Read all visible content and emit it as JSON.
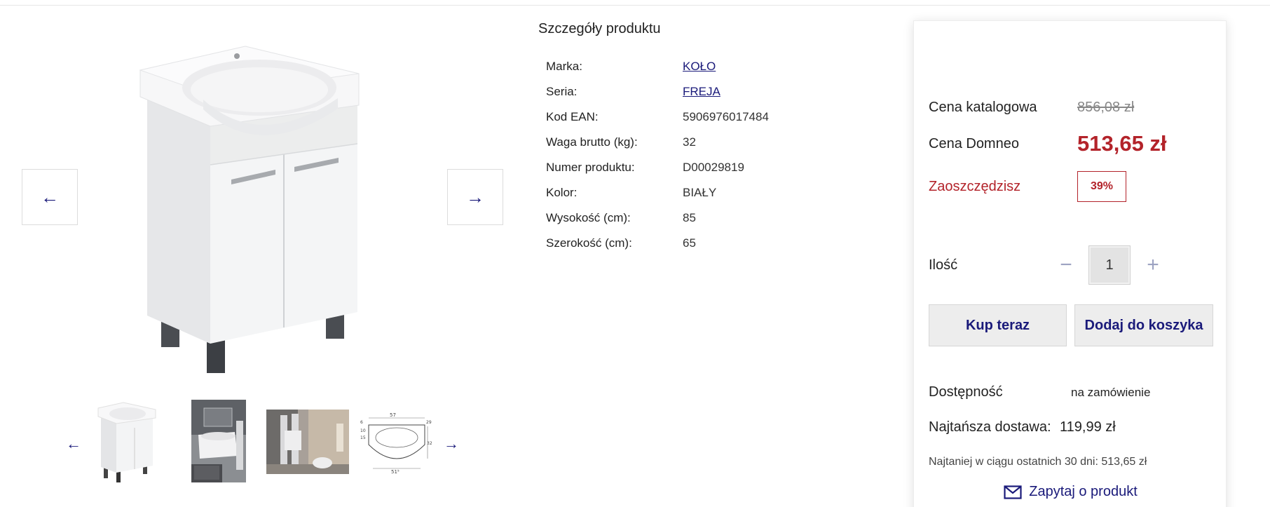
{
  "gallery": {
    "prev_arrow": "←",
    "next_arrow": "→",
    "thumb_prev": "←",
    "thumb_next": "→"
  },
  "details": {
    "title": "Szczegóły produktu",
    "specs": [
      {
        "label": "Marka:",
        "value": "KOŁO",
        "link": true
      },
      {
        "label": "Seria:",
        "value": "FREJA",
        "link": true
      },
      {
        "label": "Kod EAN:",
        "value": "5906976017484",
        "link": false
      },
      {
        "label": "Waga brutto (kg):",
        "value": "32",
        "link": false
      },
      {
        "label": "Numer produktu:",
        "value": "D00029819",
        "link": false
      },
      {
        "label": "Kolor:",
        "value": "BIAŁY",
        "link": false
      },
      {
        "label": "Wysokość (cm):",
        "value": "85",
        "link": false
      },
      {
        "label": "Szerokość (cm):",
        "value": "65",
        "link": false
      }
    ]
  },
  "purchase": {
    "list_price_label": "Cena katalogowa",
    "list_price": "856,08 zł",
    "our_price_label": "Cena Domneo",
    "our_price": "513,65 zł",
    "save_label": "Zaoszczędzisz",
    "save_value": "39%",
    "qty_label": "Ilość",
    "qty_minus": "−",
    "qty_value": "1",
    "qty_plus": "+",
    "buy_now": "Kup teraz",
    "add_to_cart": "Dodaj do koszyka",
    "availability_label": "Dostępność",
    "availability_value": "na zamówienie",
    "shipping_label": "Najtańsza dostawa:",
    "shipping_value": "119,99 zł",
    "lowest_price_note": "Najtaniej w ciągu ostatnich 30 dni: 513,65 zł",
    "ask_link": "Zapytaj o produkt"
  },
  "colors": {
    "accent": "#1a1a7a",
    "sale": "#b3232a"
  }
}
